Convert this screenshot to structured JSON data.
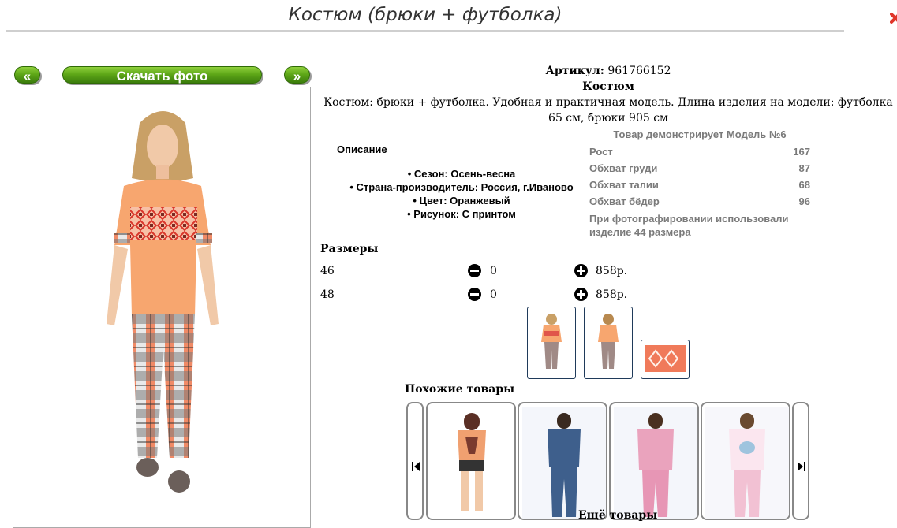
{
  "page": {
    "title": "Костюм (брюки + футболка)"
  },
  "gallery": {
    "prev_label": "«",
    "next_label": "»",
    "download_label": "Скачать фото"
  },
  "product": {
    "article_label": "Артикул:",
    "article_value": "961766152",
    "name": "Костюм",
    "description": "Костюм: брюки + футболка. Удобная и практичная модель. Длина изделия на модели: футболка 65 см, брюки 905 см"
  },
  "properties": {
    "heading": "Описание",
    "items": [
      "Сезон: Осень-весна",
      "Страна-производитель: Россия, г.Иваново",
      "Цвет: Оранжевый",
      "Рисунок: С принтом"
    ]
  },
  "model": {
    "heading": "Товар демонстрирует Модель №6",
    "rows": [
      {
        "label": "Рост",
        "value": "167"
      },
      {
        "label": "Обхват груди",
        "value": "87"
      },
      {
        "label": "Обхват талии",
        "value": "68"
      },
      {
        "label": "Обхват бёдер",
        "value": "96"
      }
    ],
    "note": "При фотографировании использовали изделие 44 размера"
  },
  "sizes": {
    "heading": "Размеры",
    "rows": [
      {
        "size": "46",
        "qty": "0",
        "price": "858р."
      },
      {
        "size": "48",
        "qty": "0",
        "price": "858р."
      }
    ]
  },
  "similar": {
    "heading": "Похожие товары"
  },
  "more": {
    "heading": "Ещё товары"
  },
  "colors": {
    "button_green": "#5fa818",
    "shirt_orange": "#f7a66f",
    "pattern_red": "#e04a3a"
  }
}
